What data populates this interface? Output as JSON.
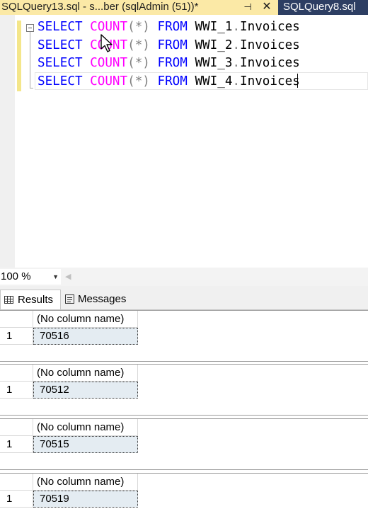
{
  "tabs": {
    "active_title": "SQLQuery13.sql - s...ber (sqlAdmin (51))*",
    "pin_glyph": "⊣",
    "close_glyph": "✕",
    "inactive_title": "SQLQuery8.sql"
  },
  "editor": {
    "lines": [
      {
        "kw1": "SELECT",
        "fn": "COUNT",
        "args": "(*)",
        "kw2": "FROM",
        "schema": "WWI_1",
        "dot": ".",
        "table": "Invoices"
      },
      {
        "kw1": "SELECT",
        "fn": "COUNT",
        "args": "(*)",
        "kw2": "FROM",
        "schema": "WWI_2",
        "dot": ".",
        "table": "Invoices"
      },
      {
        "kw1": "SELECT",
        "fn": "COUNT",
        "args": "(*)",
        "kw2": "FROM",
        "schema": "WWI_3",
        "dot": ".",
        "table": "Invoices"
      },
      {
        "kw1": "SELECT",
        "fn": "COUNT",
        "args": "(*)",
        "kw2": "FROM",
        "schema": "WWI_4",
        "dot": ".",
        "table": "Invoices"
      }
    ]
  },
  "zoom": {
    "value": "100 %",
    "arrow": "▼",
    "scroll_left": "◀"
  },
  "result_tabs": {
    "results": "Results",
    "messages": "Messages"
  },
  "results": [
    {
      "column": "(No column name)",
      "row": "1",
      "value": "70516"
    },
    {
      "column": "(No column name)",
      "row": "1",
      "value": "70512"
    },
    {
      "column": "(No column name)",
      "row": "1",
      "value": "70515"
    },
    {
      "column": "(No column name)",
      "row": "1",
      "value": "70519"
    }
  ],
  "colors": {
    "keyword": "#0000ff",
    "function": "#ff00ff",
    "operator": "#808080",
    "active_tab": "#fbe9a6",
    "tab_strip": "#2d3e63",
    "selected_cell": "#e4ecf2"
  }
}
